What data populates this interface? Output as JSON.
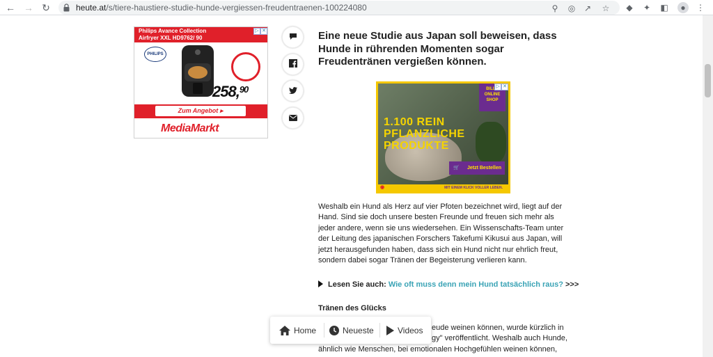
{
  "browser": {
    "url_domain": "heute.at",
    "url_path": "/s/tiere-haustiere-studie-hunde-vergiessen-freudentraenen-100224080"
  },
  "ad1": {
    "title_line1": "Philips Avance Collection",
    "title_line2": "Airfryer XXL HD9762/ 90",
    "brand": "PHILIPS",
    "price_main": "258,",
    "price_cents": "90",
    "button": "Zum Angebot",
    "store": "MediaMarkt"
  },
  "share": {
    "items": [
      "comment-icon",
      "facebook-icon",
      "twitter-icon",
      "mail-icon"
    ]
  },
  "article": {
    "lead": "Eine neue Studie aus Japan soll beweisen, dass Hunde in rührenden Momenten sogar Freudentränen vergießen können.",
    "paragraph1": "Weshalb ein Hund als Herz auf vier Pfoten bezeichnet wird, liegt auf der Hand. Sind sie doch unsere besten Freunde und freuen sich mehr als jeder andere, wenn sie uns wiedersehen. Ein Wissenschafts-Team unter der Leitung des japanischen Forschers Takefumi Kikusui aus Japan, will jetzt herausgefunden haben, dass sich ein Hund nicht nur ehrlich freut, sondern dabei sogar Tränen der Begeisterung verlieren kann.",
    "readmore_prefix": "Lesen Sie auch:",
    "readmore_link": "Wie oft muss denn mein Hund tatsächlich raus?",
    "readmore_suffix": ">>>",
    "subhead": "Tränen des Glücks",
    "paragraph2_line1": "eude weinen können, wurde kürzlich in",
    "paragraph2_line2": "gy\" veröffentlicht. Weshalb auch Hunde,",
    "paragraph2_line3": "ähnlich wie Menschen, bei emotionalen Hochgefühlen weinen können,"
  },
  "ad2": {
    "headline": "1.100 REIN PFLANZLICHE PRODUKTE",
    "badge": "BILLA ONLINE SHOP",
    "button": "Jetzt Bestellen",
    "footer": "MIT EINEM KLICK VOLLER LEBEN."
  },
  "bottomnav": {
    "home": "Home",
    "newest": "Neueste",
    "videos": "Videos"
  }
}
